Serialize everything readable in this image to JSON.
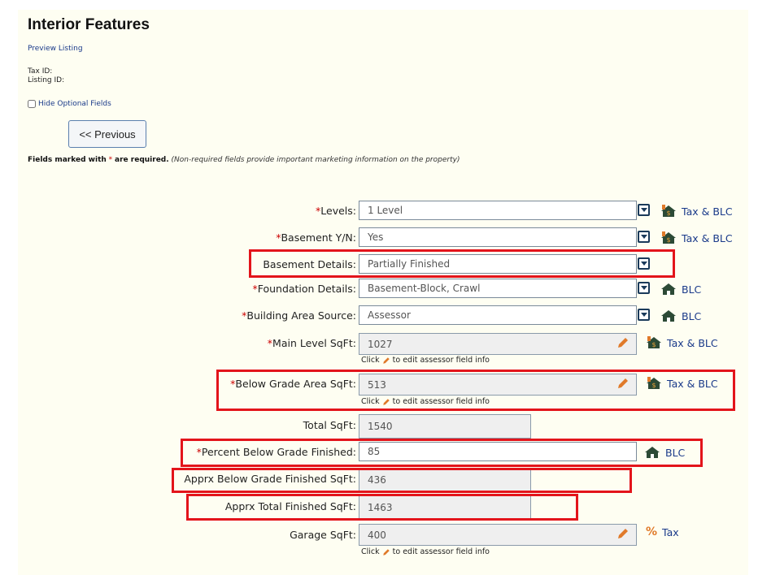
{
  "page": {
    "title": "Interior Features",
    "preview_link": "Preview Listing",
    "tax_id_label": "Tax ID:",
    "listing_id_label": "Listing ID:",
    "hide_optional_label": "Hide Optional Fields",
    "previous_button": "<< Previous",
    "required_note_bold_a": "Fields marked with",
    "required_note_star": "*",
    "required_note_bold_b": "are required.",
    "required_note_italic": "(Non-required fields provide important marketing information on the property)"
  },
  "hint_text": "to edit assessor field info",
  "hint_click": "Click",
  "fields": {
    "levels": {
      "label": "Levels:",
      "required": "*",
      "value": "1 Level",
      "source": "Tax & BLC"
    },
    "basement_yn": {
      "label": "Basement Y/N:",
      "required": "*",
      "value": "Yes",
      "source": "Tax & BLC"
    },
    "basement_details": {
      "label": "Basement Details:",
      "value": "Partially Finished"
    },
    "foundation": {
      "label": "Foundation Details:",
      "required": "*",
      "value": "Basement-Block, Crawl",
      "source": "BLC"
    },
    "building_area_source": {
      "label": "Building Area Source:",
      "required": "*",
      "value": "Assessor",
      "source": "BLC"
    },
    "main_level_sqft": {
      "label": "Main Level SqFt:",
      "required": "*",
      "value": "1027",
      "source": "Tax & BLC"
    },
    "below_grade_sqft": {
      "label": "Below Grade Area SqFt:",
      "required": "*",
      "value": "513",
      "source": "Tax & BLC"
    },
    "total_sqft": {
      "label": "Total SqFt:",
      "value": "1540"
    },
    "pct_below_finished": {
      "label": "Percent Below Grade Finished:",
      "required": "*",
      "value": "85",
      "source": "BLC"
    },
    "apprx_below_finished": {
      "label": "Apprx Below Grade Finished SqFt:",
      "value": "436"
    },
    "apprx_total_finished": {
      "label": "Apprx Total Finished SqFt:",
      "value": "1463"
    },
    "garage_sqft": {
      "label": "Garage SqFt:",
      "value": "400",
      "source": "Tax"
    }
  },
  "colors": {
    "highlight": "#e3141b",
    "link": "#1a3a8a",
    "required": "#cc0000",
    "pencil": "#e07a2a"
  }
}
